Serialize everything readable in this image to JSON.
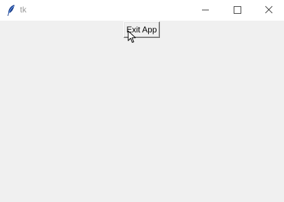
{
  "window": {
    "title": "tk",
    "icon": "feather-icon",
    "controls": [
      "minimize-icon",
      "maximize-icon",
      "close-icon"
    ]
  },
  "main": {
    "exit_button_label": "Exit App"
  },
  "colors": {
    "background": "#f0f0f0",
    "titlebar": "#ffffff",
    "title_text": "#9a9a9a"
  }
}
